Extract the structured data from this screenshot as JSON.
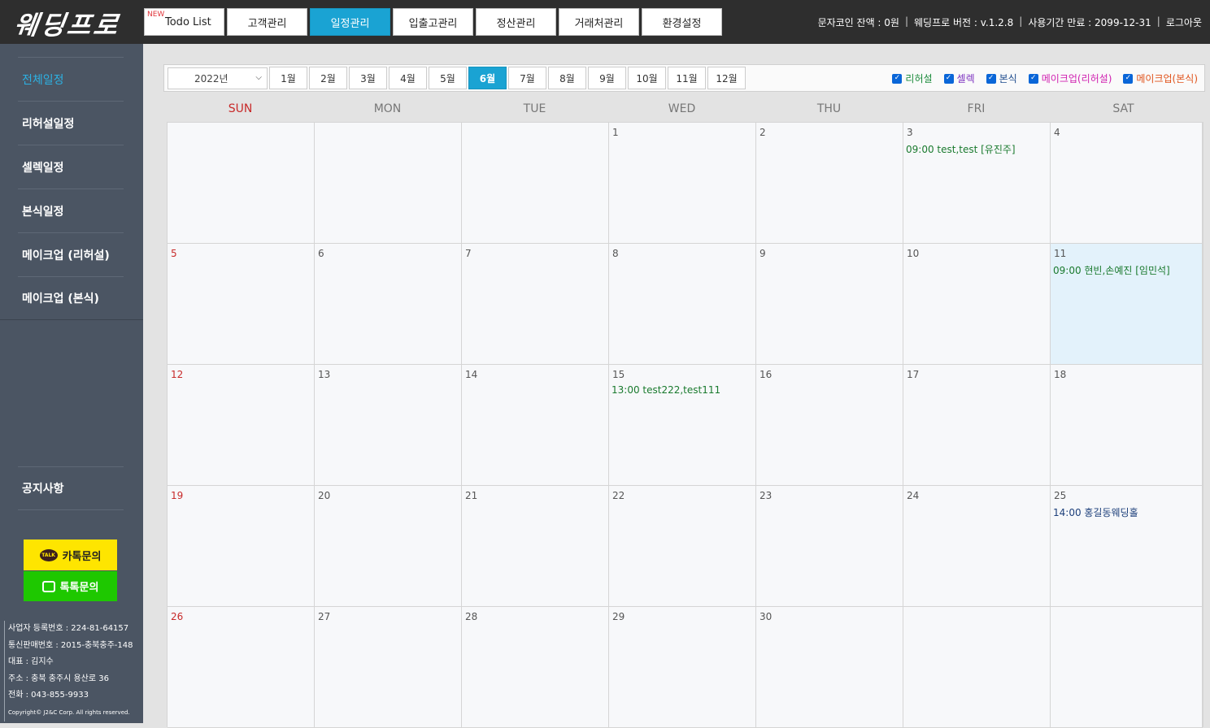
{
  "logo": "웨딩프로",
  "menu": [
    {
      "label": "Todo List",
      "badge": "NEW",
      "active": false
    },
    {
      "label": "고객관리",
      "active": false
    },
    {
      "label": "일정관리",
      "active": true
    },
    {
      "label": "입출고관리",
      "active": false
    },
    {
      "label": "정산관리",
      "active": false
    },
    {
      "label": "거래처관리",
      "active": false
    },
    {
      "label": "환경설정",
      "active": false
    }
  ],
  "header_info": {
    "sms_balance": "문자코인 잔액 : 0원",
    "version": "웨딩프로 버전 : v.1.2.8",
    "expiry": "사용기간 만료 : 2099-12-31",
    "logout": "로그아웃"
  },
  "sidebar": {
    "items": [
      {
        "label": "전체일정",
        "active": true
      },
      {
        "label": "리허설일정"
      },
      {
        "label": "셀렉일정"
      },
      {
        "label": "본식일정"
      },
      {
        "label": "메이크업 (리허설)"
      },
      {
        "label": "메이크업 (본식)"
      }
    ],
    "notice": "공지사항",
    "kakao_button": "카톡문의",
    "kakao_icon_text": "TALK",
    "talk_button": "톡톡문의"
  },
  "company": {
    "biz_no": "사업자 등록번호 : 224-81-64157",
    "mail_order": "통신판매번호 : 2015-충북충주-148",
    "ceo": "대표 : 김지수",
    "address": "주소 : 충북 충주시 용산로 36",
    "phone": "전화 : 043-855-9933",
    "copyright": "Copyright© J2&C Corp. All rights reserved."
  },
  "filterbar": {
    "year": "2022년",
    "months": [
      "1월",
      "2월",
      "3월",
      "4월",
      "5월",
      "6월",
      "7월",
      "8월",
      "9월",
      "10월",
      "11월",
      "12월"
    ],
    "active_month": "6월",
    "filters": [
      {
        "label": "리허설",
        "color": "#1a8a3a",
        "checked": true
      },
      {
        "label": "셀렉",
        "color": "#7b2fbf",
        "checked": true
      },
      {
        "label": "본식",
        "color": "#1c4a8c",
        "checked": true
      },
      {
        "label": "메이크업(리허설)",
        "color": "#d020b0",
        "checked": true
      },
      {
        "label": "메이크업(본식)",
        "color": "#e0521a",
        "checked": true
      }
    ]
  },
  "weekdays": [
    "SUN",
    "MON",
    "TUE",
    "WED",
    "THU",
    "FRI",
    "SAT"
  ],
  "calendar": {
    "weeks": [
      [
        "",
        "",
        "",
        "1",
        "2",
        "3",
        "4"
      ],
      [
        "5",
        "6",
        "7",
        "8",
        "9",
        "10",
        "11"
      ],
      [
        "12",
        "13",
        "14",
        "15",
        "16",
        "17",
        "18"
      ],
      [
        "19",
        "20",
        "21",
        "22",
        "23",
        "24",
        "25"
      ],
      [
        "26",
        "27",
        "28",
        "29",
        "30",
        "",
        ""
      ]
    ],
    "events": [
      {
        "day": "3",
        "text": "09:00 test,test [유진주]",
        "color": "#1a7a2e"
      },
      {
        "day": "11",
        "text": "09:00 현빈,손예진 [임민석]",
        "color": "#1a7a2e"
      },
      {
        "day": "15",
        "text": "13:00 test222,test111",
        "color": "#1a7a2e"
      },
      {
        "day": "25",
        "text": "14:00 홍길동웨딩홀",
        "color": "#1c3f7a"
      }
    ],
    "highlight_day": "11"
  }
}
